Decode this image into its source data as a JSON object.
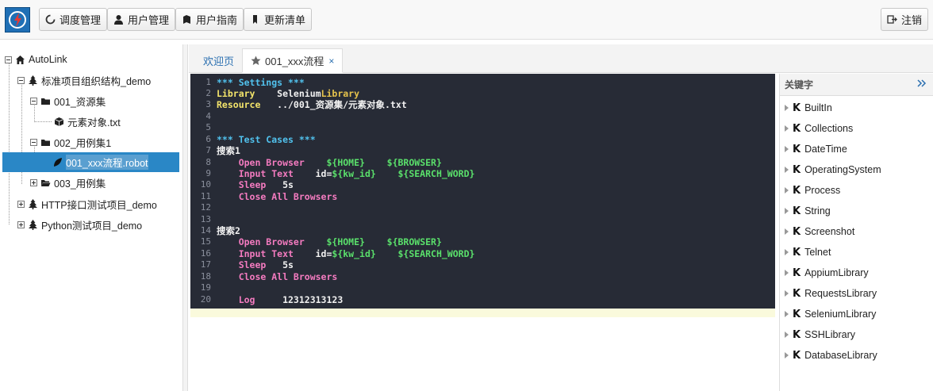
{
  "topbar": {
    "buttons": [
      {
        "label": "调度管理",
        "icon": "refresh-icon"
      },
      {
        "label": "用户管理",
        "icon": "user-icon"
      },
      {
        "label": "用户指南",
        "icon": "book-icon"
      },
      {
        "label": "更新清单",
        "icon": "bookmark-icon"
      }
    ],
    "logout_label": "注销"
  },
  "tree": {
    "root": "AutoLink",
    "nodes": [
      {
        "label": "标准项目组织结构_demo",
        "icon": "tree-icon"
      },
      {
        "label": "001_资源集",
        "icon": "folder-icon"
      },
      {
        "label": "元素对象.txt",
        "icon": "cube-icon"
      },
      {
        "label": "002_用例集1",
        "icon": "folder-icon"
      },
      {
        "label": "001_xxx流程.robot",
        "icon": "leaf-icon"
      },
      {
        "label": "003_用例集",
        "icon": "folder-open-icon"
      },
      {
        "label": "HTTP接口测试项目_demo",
        "icon": "tree-icon"
      },
      {
        "label": "Python测试项目_demo",
        "icon": "tree-icon"
      }
    ]
  },
  "tabs": {
    "welcome": "欢迎页",
    "active": "001_xxx流程",
    "close": "×"
  },
  "editor": {
    "line_numbers": [
      "1",
      "2",
      "3",
      "4",
      "5",
      "6",
      "7",
      "8",
      "9",
      "10",
      "11",
      "12",
      "13",
      "14",
      "15",
      "16",
      "17",
      "18",
      "19",
      "20"
    ],
    "lines": {
      "l1": "*** Settings ***",
      "l2a": "Library",
      "l2b": "    Selenium",
      "l2c": "Library",
      "l3a": "Resource",
      "l3b": "   ../001_资源集/元素对象.txt",
      "l6": "*** Test Cases ***",
      "l7": "搜索1",
      "l8a": "    Open Browser",
      "l8b": "    ${HOME}",
      "l8c": "    ${BROWSER}",
      "l9a": "    Input Text",
      "l9b": "    id=",
      "l9c": "${kw_id}",
      "l9d": "    ${SEARCH_WORD}",
      "l10a": "    Sleep",
      "l10b": "   5s",
      "l11": "    Close All Browsers",
      "l14": "搜索2",
      "l15a": "    Open Browser",
      "l15b": "    ${HOME}",
      "l15c": "    ${BROWSER}",
      "l16a": "    Input Text",
      "l16b": "    id=",
      "l16c": "${kw_id}",
      "l16d": "    ${SEARCH_WORD}",
      "l17a": "    Sleep",
      "l17b": "   5s",
      "l18": "    Close All Browsers",
      "l20a": "    Log",
      "l20b": "     12312313123"
    }
  },
  "keywords": {
    "title": "关键字",
    "items": [
      "BuiltIn",
      "Collections",
      "DateTime",
      "OperatingSystem",
      "Process",
      "String",
      "Screenshot",
      "Telnet",
      "AppiumLibrary",
      "RequestsLibrary",
      "SeleniumLibrary",
      "SSHLibrary",
      "DatabaseLibrary"
    ]
  }
}
